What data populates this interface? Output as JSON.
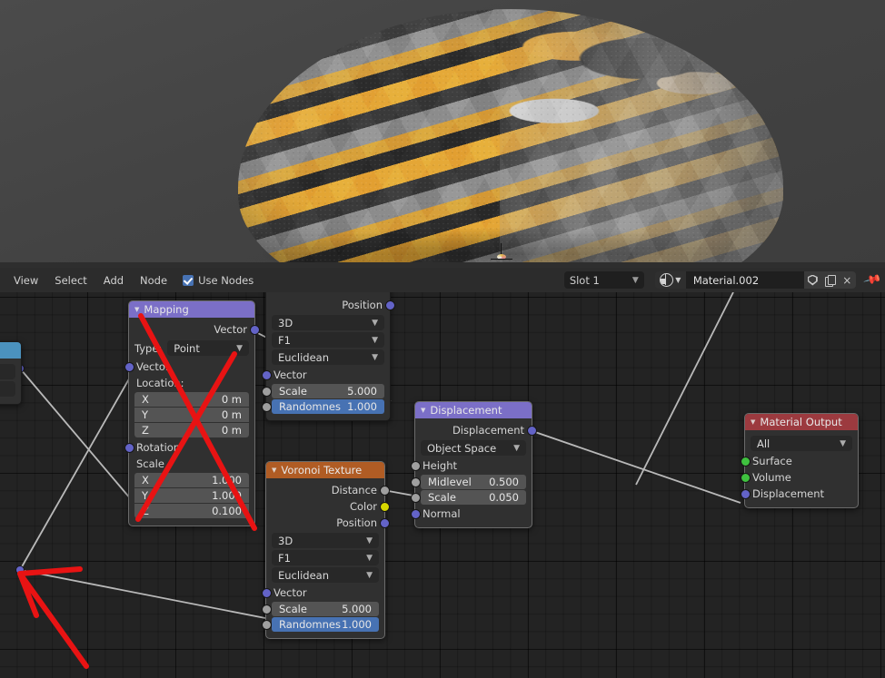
{
  "app": "Blender Shader Editor",
  "viewport": {
    "name": "3d-viewport",
    "description": "Rendered sphere with gold and gray displaced voronoi material"
  },
  "header": {
    "menus": [
      "View",
      "Select",
      "Add",
      "Node"
    ],
    "use_nodes_label": "Use Nodes",
    "use_nodes_checked": true,
    "slot_value": "Slot 1",
    "material_name": "Material.002",
    "icons": [
      "material-browse-icon",
      "fake-user-shield-icon",
      "new-material-copy-icon",
      "unlink-x-icon",
      "pin-icon"
    ],
    "unlink_label": "×"
  },
  "nodes": {
    "mapping": {
      "title": "Mapping",
      "header_color": "#7b6fc7",
      "output_label": "Vector",
      "type_label": "Type:",
      "type_value": "Point",
      "vector_label": "Vector",
      "location_label": "Location:",
      "location": [
        {
          "axis": "X",
          "value": "0 m"
        },
        {
          "axis": "Y",
          "value": "0 m"
        },
        {
          "axis": "Z",
          "value": "0 m"
        }
      ],
      "rotation_label": "Rotation",
      "scale_label": "Scale",
      "scale": [
        {
          "axis": "X",
          "value": "1.000"
        },
        {
          "axis": "Y",
          "value": "1.000"
        },
        {
          "axis": "Z",
          "value": "0.100"
        }
      ]
    },
    "voronoi_top": {
      "title": "",
      "output_label": "Position",
      "dimension": "3D",
      "feature": "F1",
      "metric": "Euclidean",
      "vector_label": "Vector",
      "scale_label": "Scale",
      "scale_value": "5.000",
      "randomness_label": "Randomnes",
      "randomness_value": "1.000"
    },
    "voronoi_bottom": {
      "title": "Voronoi Texture",
      "header_color": "#b05c24",
      "outputs": [
        "Distance",
        "Color",
        "Position"
      ],
      "dimension": "3D",
      "feature": "F1",
      "metric": "Euclidean",
      "vector_label": "Vector",
      "scale_label": "Scale",
      "scale_value": "5.000",
      "randomness_label": "Randomnes",
      "randomness_value": "1.000"
    },
    "displacement": {
      "title": "Displacement",
      "header_color": "#7b6fc7",
      "output_label": "Displacement",
      "space_value": "Object Space",
      "height_label": "Height",
      "midlevel_label": "Midlevel",
      "midlevel_value": "0.500",
      "scale_label": "Scale",
      "scale_value": "0.050",
      "normal_label": "Normal"
    },
    "material_output": {
      "title": "Material Output",
      "header_color": "#9c3a3f",
      "target_value": "All",
      "inputs": [
        "Surface",
        "Volume",
        "Displacement"
      ]
    }
  },
  "annotations": {
    "red_cross_on": "Mapping",
    "red_arrow_points_to": "link-junction-socket"
  },
  "colors": {
    "vector_socket": "#6363c7",
    "value_socket": "#9f9f9f",
    "color_socket": "#d7d700",
    "shader_socket": "#3fc13f",
    "annotation_red": "#e81313",
    "slider_blue": "#4772b3"
  }
}
